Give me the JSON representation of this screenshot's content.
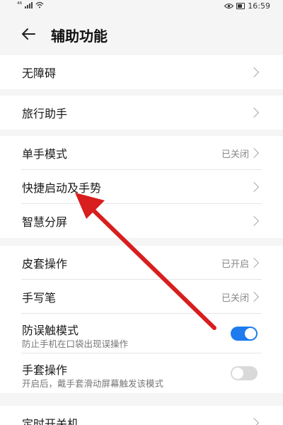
{
  "status_bar": {
    "left_text": "⁴⁶",
    "time": "16:59"
  },
  "header": {
    "title": "辅助功能"
  },
  "groups": [
    {
      "items": [
        {
          "label": "无障碍",
          "value": "",
          "control": "chevron"
        }
      ]
    },
    {
      "items": [
        {
          "label": "旅行助手",
          "value": "",
          "control": "chevron"
        }
      ]
    },
    {
      "items": [
        {
          "label": "单手模式",
          "value": "已关闭",
          "control": "chevron"
        },
        {
          "label": "快捷启动及手势",
          "value": "",
          "control": "chevron"
        },
        {
          "label": "智慧分屏",
          "value": "",
          "control": "chevron"
        }
      ]
    },
    {
      "items": [
        {
          "label": "皮套操作",
          "value": "已开启",
          "control": "chevron"
        },
        {
          "label": "手写笔",
          "value": "已关闭",
          "control": "chevron"
        },
        {
          "label": "防误触模式",
          "sublabel": "防止手机在口袋出现误操作",
          "control": "toggle",
          "state": "on"
        },
        {
          "label": "手套操作",
          "sublabel": "开启后，戴手套滑动屏幕触发该模式",
          "control": "toggle",
          "state": "off"
        }
      ]
    },
    {
      "items": [
        {
          "label": "定时开关机",
          "value": "",
          "control": "chevron"
        }
      ]
    }
  ],
  "colors": {
    "accent_blue": "#1f7bf0",
    "arrow_red": "#d81e1e"
  }
}
